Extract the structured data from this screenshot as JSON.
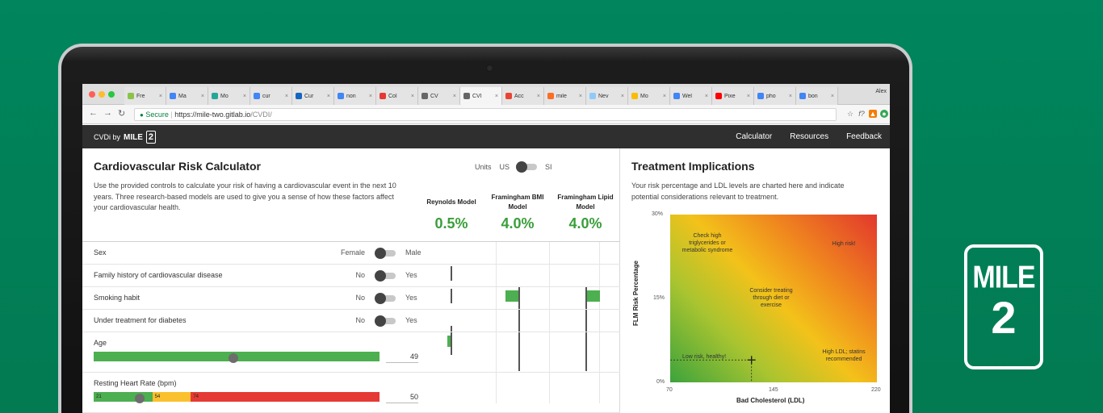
{
  "browser": {
    "tabs": [
      {
        "label": "Fre",
        "color": "#8bc34a"
      },
      {
        "label": "Ma",
        "color": "#4285f4"
      },
      {
        "label": "Mo",
        "color": "#26a69a"
      },
      {
        "label": "cur",
        "color": "#4285f4"
      },
      {
        "label": "Cur",
        "color": "#1565c0"
      },
      {
        "label": "non",
        "color": "#4285f4"
      },
      {
        "label": "Col",
        "color": "#e53935"
      },
      {
        "label": "CV",
        "color": "#666666"
      },
      {
        "label": "CVI",
        "color": "#666666",
        "active": true
      },
      {
        "label": "Acc",
        "color": "#ea4335"
      },
      {
        "label": "mile",
        "color": "#fc6d26"
      },
      {
        "label": "Nev",
        "color": "#90caf9"
      },
      {
        "label": "Mo",
        "color": "#fbbc04"
      },
      {
        "label": "Wel",
        "color": "#4285f4"
      },
      {
        "label": "Pixe",
        "color": "#ff0000"
      },
      {
        "label": "pho",
        "color": "#4285f4"
      },
      {
        "label": "bon",
        "color": "#4285f4"
      }
    ],
    "profile": "Alex",
    "secure_label": "Secure",
    "url_host": "https://mile-two.gitlab.io",
    "url_path": "/CVDI/"
  },
  "app": {
    "brand_prefix": "CVDi by",
    "brand_mile": "MILE",
    "brand_two": "2",
    "nav": [
      "Calculator",
      "Resources",
      "Feedback"
    ]
  },
  "calculator": {
    "title": "Cardiovascular Risk Calculator",
    "description": "Use the provided controls to calculate your risk of having a cardiovascular event in the next 10 years. Three research-based models are used to give you a sense of how these factors affect your cardiovascular health.",
    "units_label": "Units",
    "units_us": "US",
    "units_si": "SI",
    "models": [
      {
        "name": "Reynolds Model",
        "value": "0.5%"
      },
      {
        "name": "Framingham BMI Model",
        "value": "4.0%"
      },
      {
        "name": "Framingham Lipid Model",
        "value": "4.0%"
      }
    ],
    "toggles": [
      {
        "label": "Sex",
        "left": "Female",
        "right": "Male"
      },
      {
        "label": "Family history of cardiovascular disease",
        "left": "No",
        "right": "Yes"
      },
      {
        "label": "Smoking habit",
        "left": "No",
        "right": "Yes"
      },
      {
        "label": "Under treatment for diabetes",
        "left": "No",
        "right": "Yes"
      }
    ],
    "age": {
      "label": "Age",
      "value": "49",
      "position": 0.49
    },
    "heart_rate": {
      "label": "Resting Heart Rate (bpm)",
      "value": "50",
      "seg_labels": [
        "21",
        "54",
        "74"
      ],
      "position": 0.16
    }
  },
  "treatment": {
    "title": "Treatment Implications",
    "description": "Your risk percentage and LDL levels are charted here and indicate potential considerations relevant to treatment.",
    "y_axis_label": "FLM Risk Percentage",
    "x_axis_label": "Bad Cholesterol (LDL)",
    "y_ticks": [
      "30%",
      "15%",
      "0%"
    ],
    "x_ticks": [
      "70",
      "145",
      "220"
    ],
    "zones": [
      "Check high triglycerides or metabolic syndrome",
      "High risk!",
      "Consider treating through diet or exercise",
      "Low risk, healthy!",
      "High LDL; statins recommended"
    ],
    "marker": {
      "ldl": 129,
      "risk": 4.0
    }
  },
  "logo": {
    "line1": "MILE",
    "line2": "2"
  }
}
